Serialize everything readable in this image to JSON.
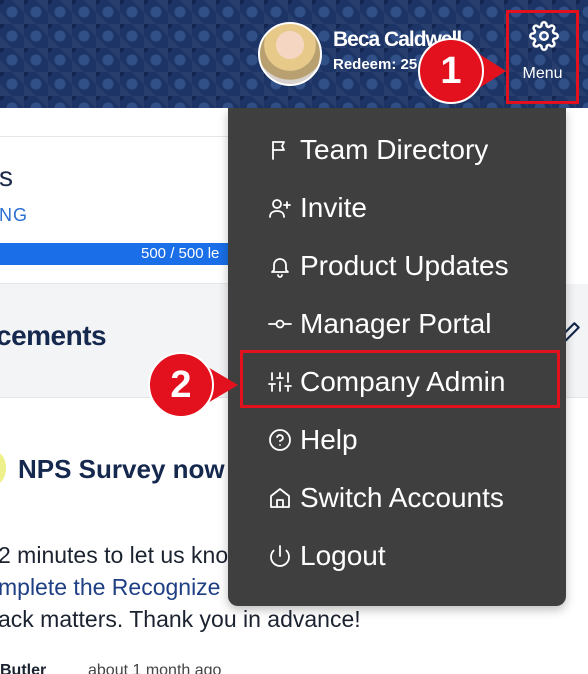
{
  "header": {
    "user_name": "Beca Caldwell",
    "redeem_text": "Redeem: 25",
    "menu_label": "Menu"
  },
  "callouts": {
    "first": "1",
    "second": "2"
  },
  "background": {
    "card_title": "s",
    "card_link": "NG",
    "progress_text": "500 / 500 le",
    "progress_fraction": 1.0,
    "section_title": "cements",
    "post_title": "NPS Survey now",
    "post_line_1": "2 minutes to let us kno",
    "post_line_2": "mplete the Recognize E",
    "post_line_3": "ack matters. Thank you in advance!",
    "post_author": "Butler",
    "post_time": "about 1 month ago"
  },
  "menu": {
    "items": [
      {
        "label": "Team Directory",
        "icon": "flag-icon"
      },
      {
        "label": "Invite",
        "icon": "user-plus-icon"
      },
      {
        "label": "Product Updates",
        "icon": "bell-icon"
      },
      {
        "label": "Manager Portal",
        "icon": "commit-icon"
      },
      {
        "label": "Company Admin",
        "icon": "sliders-icon"
      },
      {
        "label": "Help",
        "icon": "help-circle-icon"
      },
      {
        "label": "Switch Accounts",
        "icon": "home-icon"
      },
      {
        "label": "Logout",
        "icon": "power-icon"
      }
    ]
  },
  "colors": {
    "header_bg": "#1c3566",
    "menu_bg": "#3f3f3f",
    "callout_red": "#e3111e",
    "progress_blue": "#1a6ee8"
  }
}
